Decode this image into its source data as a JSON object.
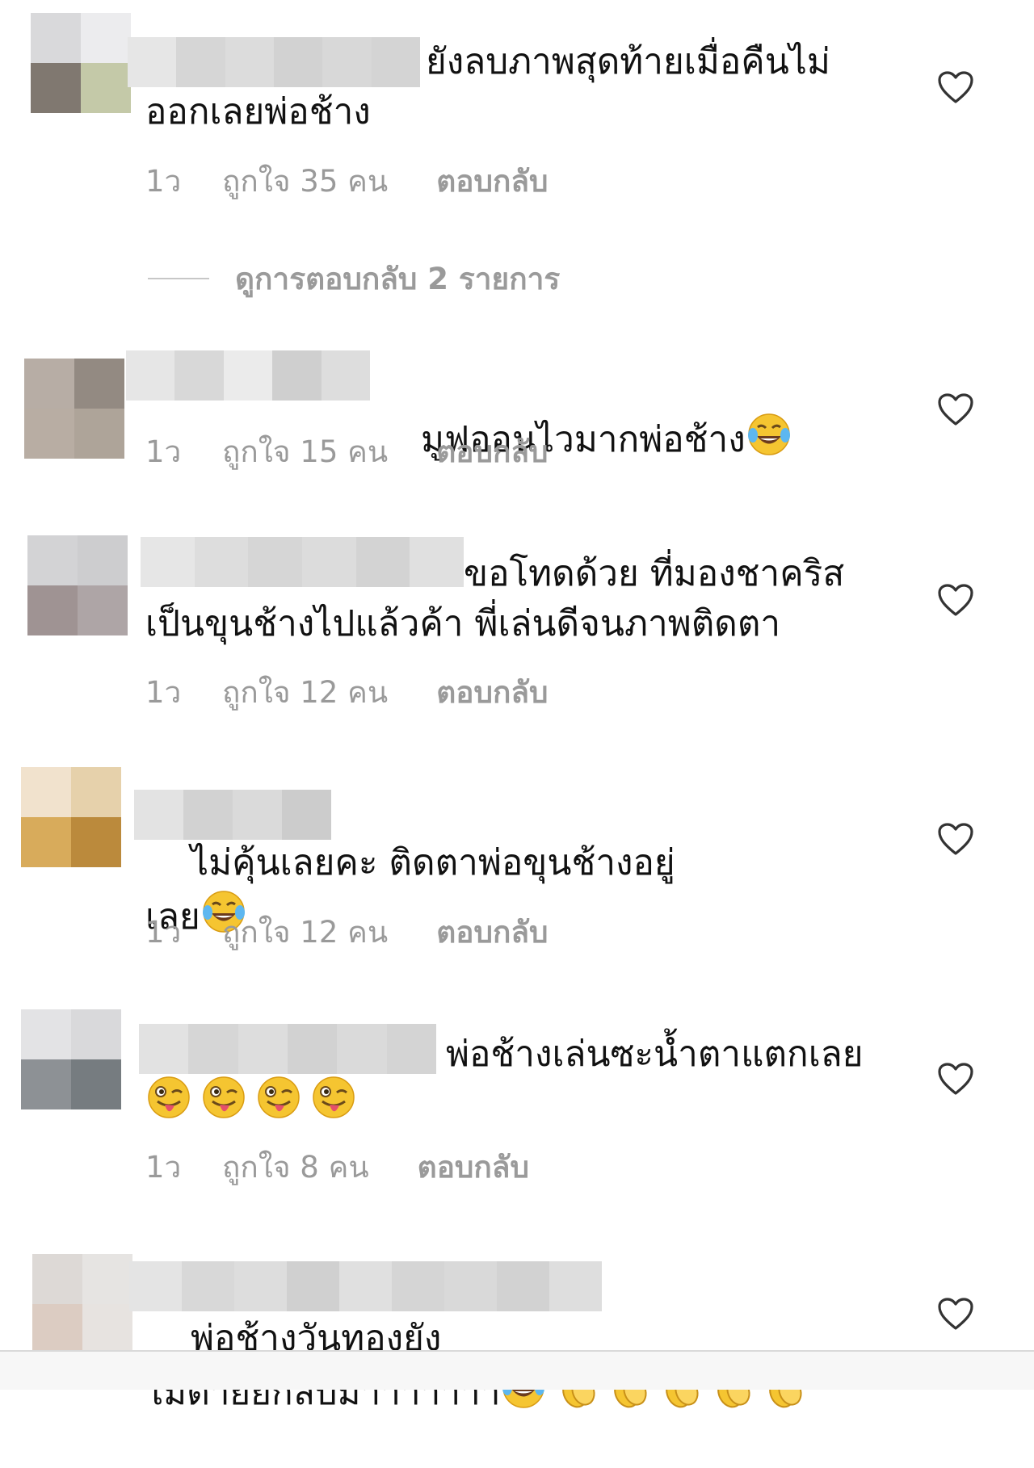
{
  "comments": [
    {
      "text": "ยังลบภาพสุดท้ายเมื่อคืนไม่\nออกเลยพ่อช้าง",
      "time": "1ว",
      "likes": "ถูกใจ 35 คน",
      "reply": "ตอบกลับ"
    },
    {
      "text": "มูฟออนไวมากพ่อช้าง",
      "time": "1ว",
      "likes": "ถูกใจ 15 คน",
      "reply": "ตอบกลับ"
    },
    {
      "text": "ขอโทดด้วย ที่มองชาคริส\nเป็นขุนช้างไปแล้วค้า พี่เล่นดีจนภาพติดตา",
      "time": "1ว",
      "likes": "ถูกใจ 12 คน",
      "reply": "ตอบกลับ"
    },
    {
      "text": "ไม่คุ้นเลยคะ ติดตาพ่อขุนช้างอยู่\nเลย",
      "time": "1ว",
      "likes": "ถูกใจ 12 คน",
      "reply": "ตอบกลับ"
    },
    {
      "text": "พ่อช้างเล่นซะน้ำตาแตกเลย",
      "time": "1ว",
      "likes": "ถูกใจ 8 คน",
      "reply": "ตอบกลับ"
    },
    {
      "text": "พ่อช้างวันทองยัง\nไม่ตายยกลับมาาาาาาา"
    }
  ],
  "view_replies": "ดูการตอบกลับ 2 รายการ",
  "icons": {
    "like": "heart-outline-icon",
    "laugh": "tears-of-joy-emoji",
    "wink": "winking-tongue-emoji",
    "clap": "clapping-hands-emoji"
  },
  "colors": {
    "text": "#111111",
    "meta": "#9a9a9a",
    "heart": "#333333"
  }
}
